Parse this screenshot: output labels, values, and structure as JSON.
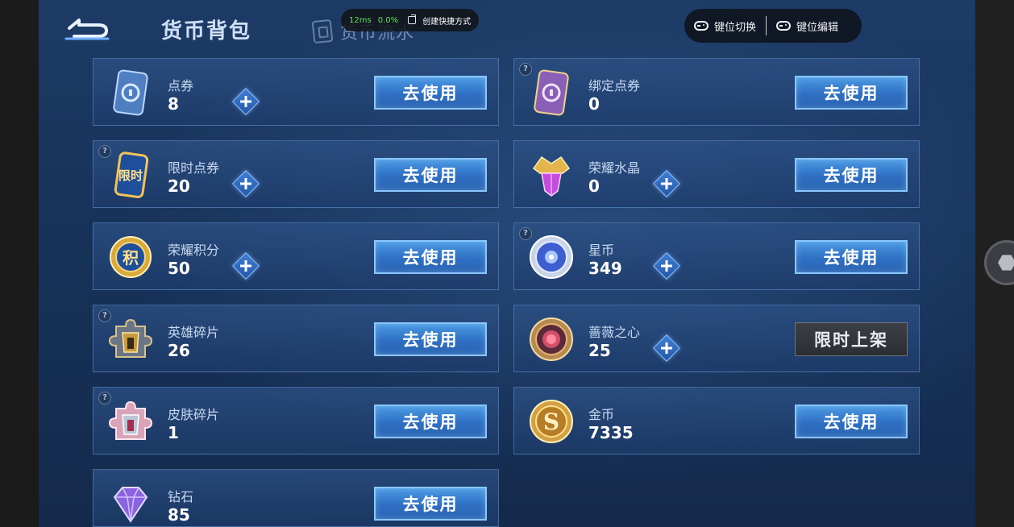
{
  "header": {
    "title": "货币背包",
    "tab_flow": "货币流水",
    "back_icon": "back-arrow-icon"
  },
  "overlay": {
    "latency": "12ms",
    "packet_loss": "0.0%",
    "shortcut_label": "创建快捷方式",
    "key_switch": "键位切换",
    "key_edit": "键位编辑"
  },
  "buttons": {
    "use": "去使用",
    "limited": "限时上架"
  },
  "currencies": [
    {
      "name": "点券",
      "value": "8",
      "icon": "voucher-card-icon"
    },
    {
      "name": "绑定点券",
      "value": "0",
      "icon": "bound-voucher-card-icon"
    },
    {
      "name": "限时点券",
      "value": "20",
      "icon": "limited-voucher-icon",
      "icon_text": "限时"
    },
    {
      "name": "荣耀水晶",
      "value": "0",
      "icon": "glory-crystal-icon"
    },
    {
      "name": "荣耀积分",
      "value": "50",
      "icon": "glory-points-icon",
      "icon_text": "积"
    },
    {
      "name": "星币",
      "value": "349",
      "icon": "star-coin-icon"
    },
    {
      "name": "英雄碎片",
      "value": "26",
      "icon": "hero-fragment-icon"
    },
    {
      "name": "蔷薇之心",
      "value": "25",
      "icon": "rose-heart-icon"
    },
    {
      "name": "皮肤碎片",
      "value": "1",
      "icon": "skin-fragment-icon"
    },
    {
      "name": "金币",
      "value": "7335",
      "icon": "gold-coin-icon",
      "icon_text": "S"
    },
    {
      "name": "钻石",
      "value": "85",
      "icon": "diamond-icon"
    }
  ]
}
